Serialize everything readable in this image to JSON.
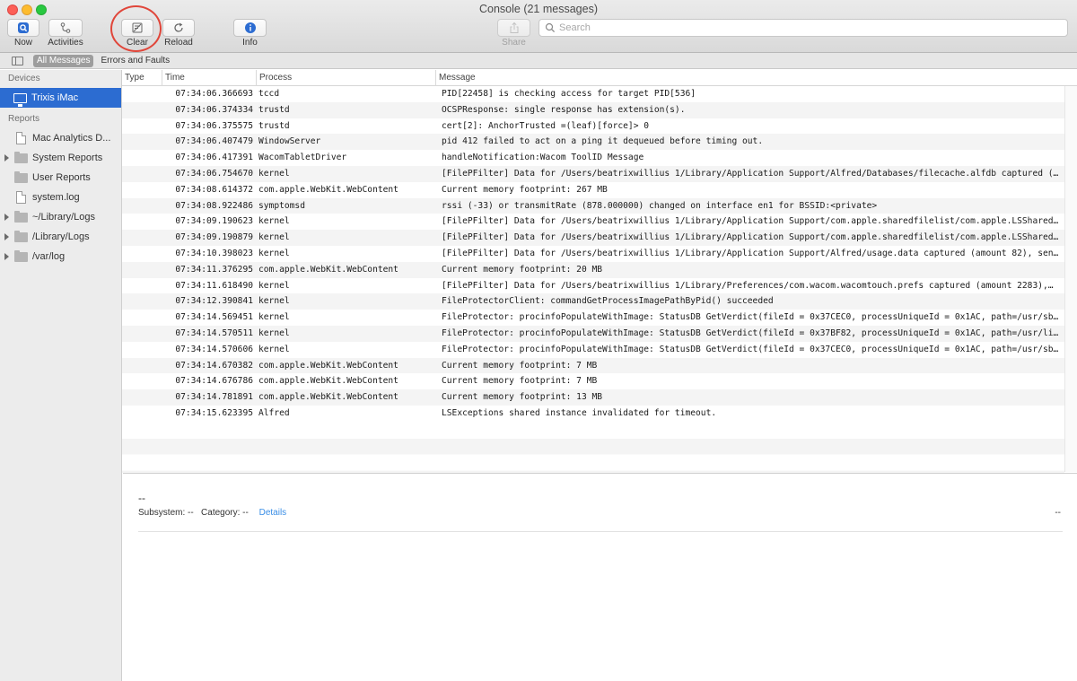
{
  "window": {
    "title": "Console (21 messages)"
  },
  "toolbar": {
    "now_label": "Now",
    "activities_label": "Activities",
    "clear_label": "Clear",
    "reload_label": "Reload",
    "info_label": "Info",
    "share_label": "Share",
    "search_placeholder": "Search",
    "accent_color": "#2c6cd1",
    "annotation_color": "#e0463a"
  },
  "filters": {
    "all_messages": "All Messages",
    "errors_and_faults": "Errors and Faults"
  },
  "sidebar": {
    "devices_header": "Devices",
    "device": "Trixis iMac",
    "reports_header": "Reports",
    "items": [
      {
        "label": "Mac Analytics D...",
        "icon": "document-icon",
        "expandable": false
      },
      {
        "label": "System Reports",
        "icon": "folder-icon",
        "expandable": true
      },
      {
        "label": "User Reports",
        "icon": "folder-icon",
        "expandable": false
      },
      {
        "label": "system.log",
        "icon": "document-icon",
        "expandable": false
      },
      {
        "label": "~/Library/Logs",
        "icon": "folder-icon",
        "expandable": true
      },
      {
        "label": "/Library/Logs",
        "icon": "folder-icon",
        "expandable": true
      },
      {
        "label": "/var/log",
        "icon": "folder-icon",
        "expandable": true
      }
    ]
  },
  "table": {
    "columns": [
      "Type",
      "Time",
      "Process",
      "Message"
    ],
    "rows": [
      {
        "time": "07:34:06.366693",
        "process": "tccd",
        "message": "PID[22458] is checking access for target PID[536]"
      },
      {
        "time": "07:34:06.374334",
        "process": "trustd",
        "message": "OCSPResponse: single response has extension(s)."
      },
      {
        "time": "07:34:06.375575",
        "process": "trustd",
        "message": "cert[2]: AnchorTrusted =(leaf)[force]> 0"
      },
      {
        "time": "07:34:06.407479",
        "process": "WindowServer",
        "message": "pid 412 failed to act on a ping it dequeued before timing out."
      },
      {
        "time": "07:34:06.417391",
        "process": "WacomTabletDriver",
        "message": "handleNotification:Wacom ToolID Message"
      },
      {
        "time": "07:34:06.754670",
        "process": "kernel",
        "message": "[FilePFilter] Data for /Users/beatrixwillius 1/Library/Application Support/Alfred/Databases/filecache.alfdb captured (…"
      },
      {
        "time": "07:34:08.614372",
        "process": "com.apple.WebKit.WebContent",
        "message": "Current memory footprint: 267 MB"
      },
      {
        "time": "07:34:08.922486",
        "process": "symptomsd",
        "message": "rssi (-33) or transmitRate (878.000000) changed on interface en1 for BSSID:<private>"
      },
      {
        "time": "07:34:09.190623",
        "process": "kernel",
        "message": "[FilePFilter] Data for /Users/beatrixwillius 1/Library/Application Support/com.apple.sharedfilelist/com.apple.LSShared…"
      },
      {
        "time": "07:34:09.190879",
        "process": "kernel",
        "message": "[FilePFilter] Data for /Users/beatrixwillius 1/Library/Application Support/com.apple.sharedfilelist/com.apple.LSShared…"
      },
      {
        "time": "07:34:10.398023",
        "process": "kernel",
        "message": "[FilePFilter] Data for /Users/beatrixwillius 1/Library/Application Support/Alfred/usage.data captured (amount 82), sen…"
      },
      {
        "time": "07:34:11.376295",
        "process": "com.apple.WebKit.WebContent",
        "message": "Current memory footprint: 20 MB"
      },
      {
        "time": "07:34:11.618490",
        "process": "kernel",
        "message": "[FilePFilter] Data for /Users/beatrixwillius 1/Library/Preferences/com.wacom.wacomtouch.prefs captured (amount 2283),…"
      },
      {
        "time": "07:34:12.390841",
        "process": "kernel",
        "message": "FileProtectorClient: commandGetProcessImagePathByPid() succeeded"
      },
      {
        "time": "07:34:14.569451",
        "process": "kernel",
        "message": "FileProtector: procinfoPopulateWithImage: StatusDB GetVerdict(fileId = 0x37CEC0, processUniqueId = 0x1AC, path=/usr/sb…"
      },
      {
        "time": "07:34:14.570511",
        "process": "kernel",
        "message": "FileProtector: procinfoPopulateWithImage: StatusDB GetVerdict(fileId = 0x37BF82, processUniqueId = 0x1AC, path=/usr/li…"
      },
      {
        "time": "07:34:14.570606",
        "process": "kernel",
        "message": "FileProtector: procinfoPopulateWithImage: StatusDB GetVerdict(fileId = 0x37CEC0, processUniqueId = 0x1AC, path=/usr/sb…"
      },
      {
        "time": "07:34:14.670382",
        "process": "com.apple.WebKit.WebContent",
        "message": "Current memory footprint: 7 MB"
      },
      {
        "time": "07:34:14.676786",
        "process": "com.apple.WebKit.WebContent",
        "message": "Current memory footprint: 7 MB"
      },
      {
        "time": "07:34:14.781891",
        "process": "com.apple.WebKit.WebContent",
        "message": "Current memory footprint: 13 MB"
      },
      {
        "time": "07:34:15.623395",
        "process": "Alfred",
        "message": "LSExceptions shared instance invalidated for timeout."
      }
    ]
  },
  "detail": {
    "placeholder": "--",
    "subsystem_label": "Subsystem: --",
    "category_label": "Category: --",
    "details_link": "Details",
    "right_value": "--"
  }
}
